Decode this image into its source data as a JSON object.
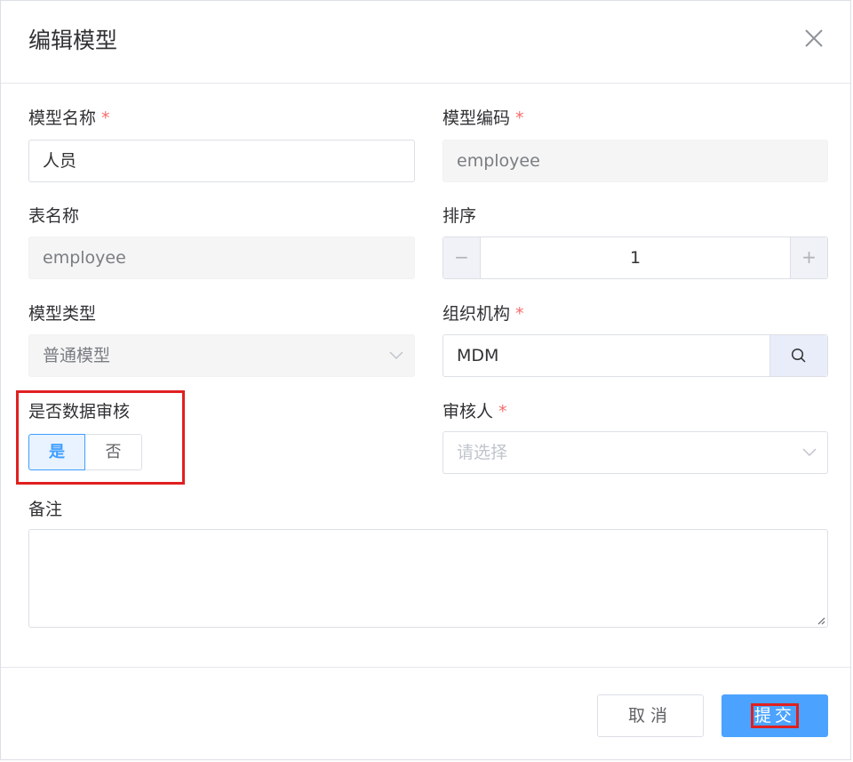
{
  "dialog": {
    "title": "编辑模型"
  },
  "form": {
    "model_name": {
      "label": "模型名称",
      "required_mark": "*",
      "value": "人员"
    },
    "model_code": {
      "label": "模型编码",
      "required_mark": "*",
      "value": "employee"
    },
    "table_name": {
      "label": "表名称",
      "value": "employee"
    },
    "sort": {
      "label": "排序",
      "value": "1",
      "minus": "−",
      "plus": "+"
    },
    "model_type": {
      "label": "模型类型",
      "value": "普通模型"
    },
    "organization": {
      "label": "组织机构",
      "required_mark": "*",
      "value": "MDM"
    },
    "data_audit": {
      "label": "是否数据审核",
      "options": [
        "是",
        "否"
      ],
      "selected": "是"
    },
    "auditor": {
      "label": "审核人",
      "required_mark": "*",
      "placeholder": "请选择"
    },
    "remark": {
      "label": "备注",
      "value": ""
    }
  },
  "footer": {
    "cancel_label": "取消",
    "submit_label": "提交"
  },
  "colors": {
    "primary": "#409eff",
    "required": "#f56c6c",
    "highlight_box": "#e02020",
    "submit_bg": "#4ba3ff"
  },
  "icons": {
    "close": "close-icon",
    "chevron": "chevron-down-icon",
    "search": "search-icon"
  }
}
